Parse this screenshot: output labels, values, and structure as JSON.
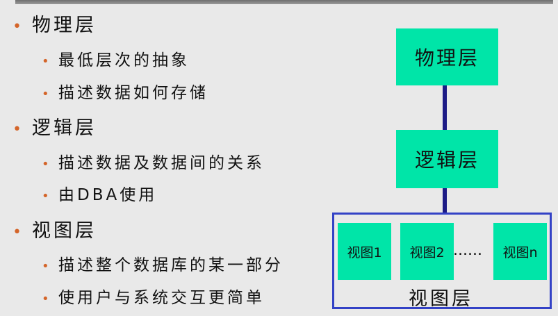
{
  "outline": [
    {
      "level": 1,
      "text": "物理层"
    },
    {
      "level": 2,
      "text": "最低层次的抽象"
    },
    {
      "level": 2,
      "text": "描述数据如何存储"
    },
    {
      "level": 1,
      "text": "逻辑层"
    },
    {
      "level": 2,
      "text": "描述数据及数据间的关系"
    },
    {
      "level": 2,
      "text": "由DBA使用"
    },
    {
      "level": 1,
      "text": "视图层"
    },
    {
      "level": 2,
      "text": "描述整个数据库的某一部分"
    },
    {
      "level": 2,
      "text": "使用户与系统交互更简单"
    }
  ],
  "diagram": {
    "physical_box": "物理层",
    "logical_box": "逻辑层",
    "views": [
      "视图1",
      "视图2",
      "视图n"
    ],
    "ellipsis": "......",
    "view_layer_label": "视图层",
    "box_color": "#00e5a8",
    "connector_color": "#1c1b86",
    "frame_color": "#3342c6",
    "bullet_color": "#d4652a"
  }
}
